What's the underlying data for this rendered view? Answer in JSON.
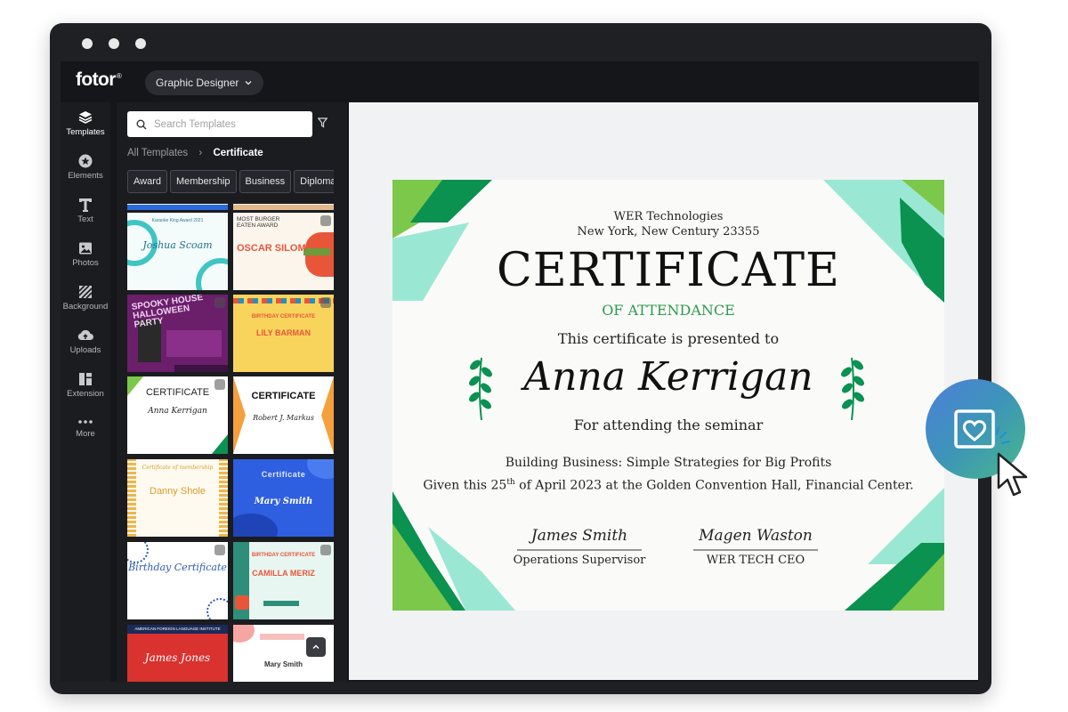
{
  "app": {
    "logo": "fotor",
    "logo_mark": "®",
    "mode_label": "Graphic Designer"
  },
  "sidebar": {
    "items": [
      {
        "label": "Templates",
        "icon": "layers-icon",
        "active": true
      },
      {
        "label": "Elements",
        "icon": "elements-icon"
      },
      {
        "label": "Text",
        "icon": "text-icon"
      },
      {
        "label": "Photos",
        "icon": "image-icon"
      },
      {
        "label": "Background",
        "icon": "background-icon"
      },
      {
        "label": "Uploads",
        "icon": "upload-cloud-icon"
      },
      {
        "label": "Extension",
        "icon": "extension-icon"
      },
      {
        "label": "More",
        "icon": "more-icon"
      }
    ]
  },
  "panel": {
    "search_placeholder": "Search Templates",
    "breadcrumb": {
      "root": "All Templates",
      "current": "Certificate"
    },
    "chips": [
      "Award",
      "Membership",
      "Business",
      "Diploma"
    ],
    "templates": [
      {
        "title": "Joshua Scoam",
        "top": "Karaoke King Award 2021"
      },
      {
        "title": "OSCAR SILOM",
        "top": "MOST BURGER EATEN AWARD"
      },
      {
        "title": "SPOOKY HOUSE HALLOWEEN PARTY",
        "top": ""
      },
      {
        "title": "LILY BARMAN",
        "top": "BIRTHDAY CERTIFICATE"
      },
      {
        "title": "Anna Kerrigan",
        "top": "CERTIFICATE"
      },
      {
        "title": "Robert J. Markus",
        "top": "CERTIFICATE"
      },
      {
        "title": "Danny Shole",
        "top": "Certificate of membership"
      },
      {
        "title": "Mary Smith",
        "top": "Certificate"
      },
      {
        "title": "Birthday Certificate",
        "top": ""
      },
      {
        "title": "CAMILLA MERIZ",
        "top": "BIRTHDAY CERTIFICATE"
      },
      {
        "title": "James Jones",
        "top": "AMERICAN FOREIGN LANGUAGE INSTITUTE"
      },
      {
        "title": "Mary Smith",
        "top": ""
      }
    ]
  },
  "certificate": {
    "company": "WER Technologies",
    "address": "New York, New Century 23355",
    "title": "CERTIFICATE",
    "subtitle": "OF ATTENDANCE",
    "presented": "This certificate is presented to",
    "recipient": "Anna Kerrigan",
    "reason": "For attending the seminar",
    "event": "Building Business: Simple Strategies for Big Profits",
    "given_prefix": "Given this 25",
    "given_sup": "th",
    "given_suffix": " of April 2023 at the Golden Convention Hall, Financial Center.",
    "sign1": {
      "signature": "James Smith",
      "role": "Operations Supervisor"
    },
    "sign2": {
      "signature": "Magen Waston",
      "role": "WER TECH CEO"
    }
  },
  "colors": {
    "green_dark": "#0b9150",
    "green_light": "#7cc84a",
    "mint": "#9ae8d4",
    "accent_text": "#2e9a4d"
  }
}
